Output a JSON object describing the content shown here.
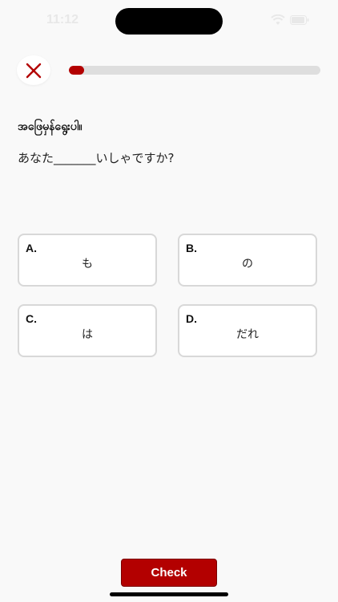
{
  "status_bar": {
    "time": "11:12",
    "wifi_icon": "wifi-icon",
    "battery_icon": "battery-icon"
  },
  "quiz": {
    "close_icon": "close-icon",
    "progress": 0.06,
    "accent_color": "#b30000",
    "instruction": "အဖြေမှန်ရွေးပါ။",
    "question": "あなた_______いしゃですか?",
    "options": [
      {
        "letter": "A.",
        "text": "も"
      },
      {
        "letter": "B.",
        "text": "の"
      },
      {
        "letter": "C.",
        "text": "は"
      },
      {
        "letter": "D.",
        "text": "だれ"
      }
    ],
    "check_label": "Check"
  }
}
